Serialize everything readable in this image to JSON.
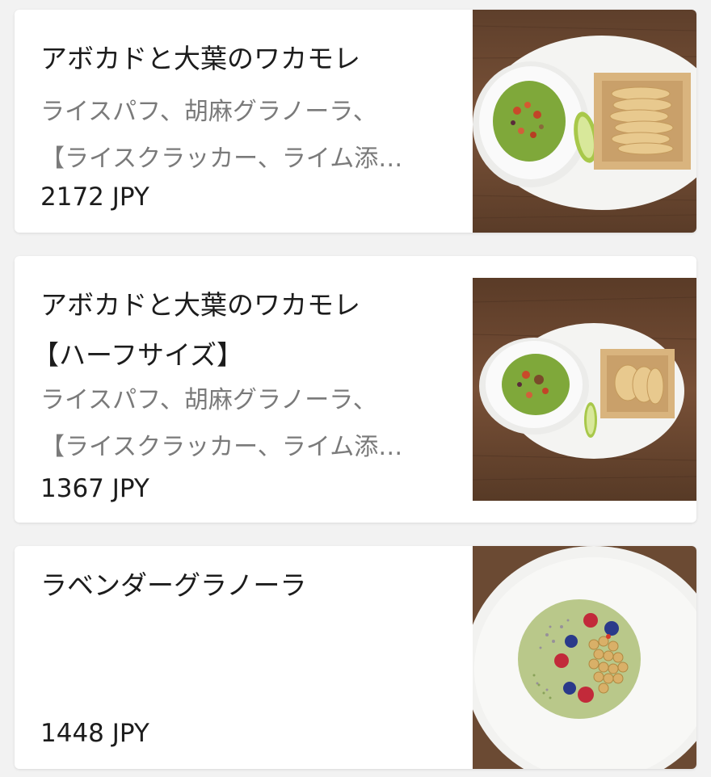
{
  "menu": {
    "items": [
      {
        "title": "アボカドと大葉のワカモレ",
        "title_line2": "",
        "desc_line1": "ライスパフ、胡麻グラノーラ、",
        "desc_line2": "【ライスクラッカー、ライム添…",
        "price": "2172 JPY",
        "photo_icon": "guacamole-photo"
      },
      {
        "title": "アボカドと大葉のワカモレ",
        "title_line2": "【ハーフサイズ】",
        "desc_line1": "ライスパフ、胡麻グラノーラ、",
        "desc_line2": "【ライスクラッカー、ライム添…",
        "price": "1367 JPY",
        "photo_icon": "guacamole-half-photo"
      },
      {
        "title": "ラベンダーグラノーラ",
        "title_line2": "",
        "desc_line1": "",
        "desc_line2": "",
        "price": "1448 JPY",
        "photo_icon": "granola-bowl-photo"
      }
    ]
  },
  "colors": {
    "card_bg": "#ffffff",
    "page_bg": "#f2f2f2",
    "title_text": "#1c1c1c",
    "desc_text": "#7a7a7a",
    "wood": "#6b4a33",
    "guacamole": "#7fa83a",
    "matcha": "#b9c88a"
  }
}
